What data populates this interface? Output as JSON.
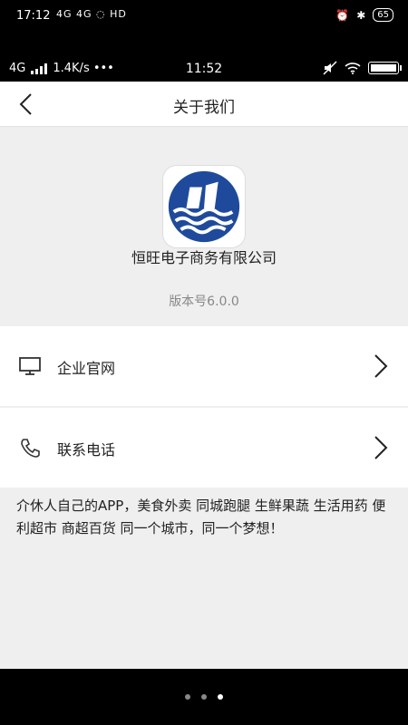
{
  "outer_status": {
    "time": "17:12",
    "signal": "4G 4G",
    "net": "HD",
    "battery": "65"
  },
  "inner_status": {
    "network": "4G",
    "speed": "1.4K/s •••",
    "time": "11:52"
  },
  "navbar": {
    "title": "关于我们",
    "back_icon": "chevron-left-icon"
  },
  "about": {
    "company": "恒旺电子商务有限公司",
    "version": "版本号6.0.0"
  },
  "menu": [
    {
      "label": "企业官网",
      "icon": "monitor-icon"
    },
    {
      "label": "联系电话",
      "icon": "phone-icon"
    }
  ],
  "description": "介休人自己的APP，美食外卖 同城跑腿 生鲜果蔬 生活用药 便利超市 商超百货 同一个城市，同一个梦想！",
  "pager": {
    "count": 3,
    "active": 3
  }
}
